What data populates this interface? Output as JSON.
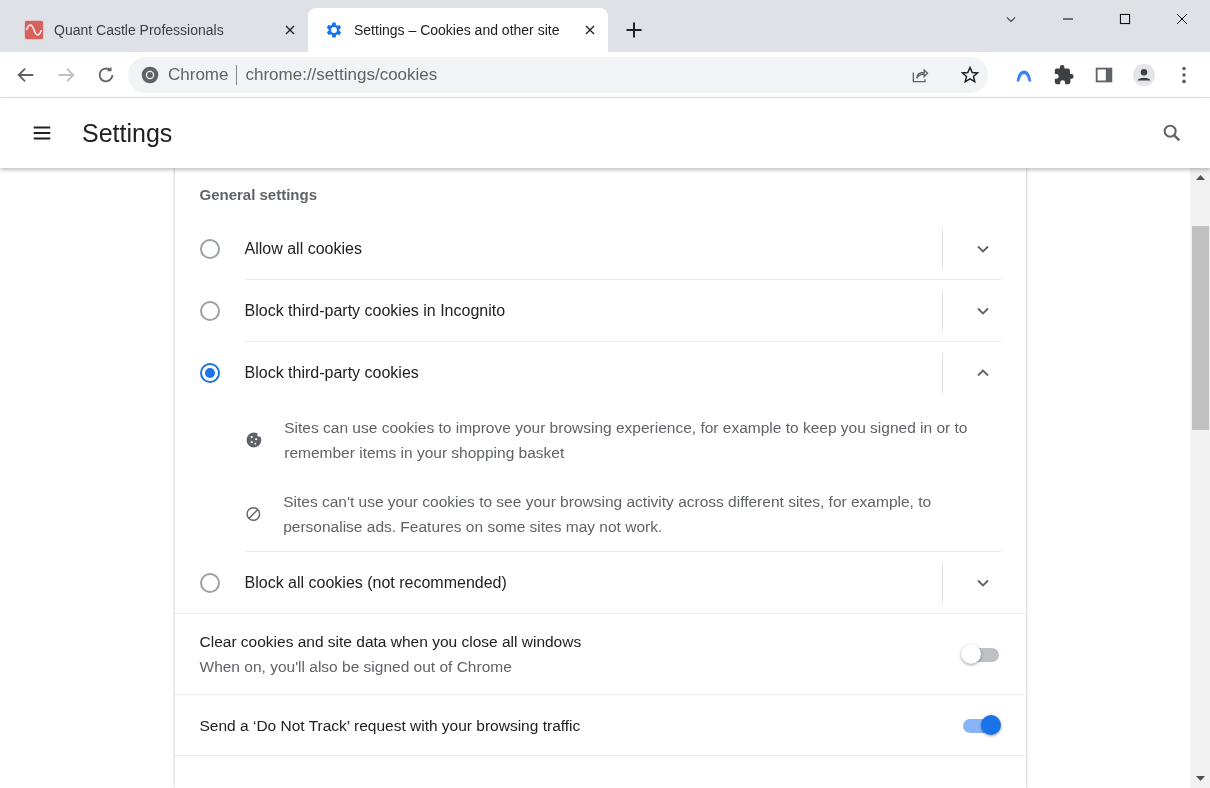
{
  "tabs": [
    {
      "kind": "site",
      "title": "Quant Castle Professionals",
      "selected": false
    },
    {
      "kind": "settings",
      "title": "Settings – Cookies and other site",
      "selected": true
    }
  ],
  "omnibox": {
    "origin": "Chrome",
    "url": "chrome://settings/cookies"
  },
  "header": {
    "title": "Settings"
  },
  "section_title": "General settings",
  "options": [
    {
      "label": "Allow all cookies",
      "selected": false,
      "expanded": false
    },
    {
      "label": "Block third-party cookies in Incognito",
      "selected": false,
      "expanded": false
    },
    {
      "label": "Block third-party cookies",
      "selected": true,
      "expanded": true,
      "details": [
        {
          "kind": "cookie",
          "text": "Sites can use cookies to improve your browsing experience, for example to keep you signed in or to remember items in your shopping basket"
        },
        {
          "kind": "block",
          "text": "Sites can't use your cookies to see your browsing activity across different sites, for example, to personalise ads. Features on some sites may not work."
        }
      ]
    },
    {
      "label": "Block all cookies (not recommended)",
      "selected": false,
      "expanded": false
    }
  ],
  "toggles": [
    {
      "label": "Clear cookies and site data when you close all windows",
      "sublabel": "When on, you'll also be signed out of Chrome",
      "on": false
    },
    {
      "label": "Send a ‘Do Not Track’ request with your browsing traffic",
      "on": true
    }
  ]
}
